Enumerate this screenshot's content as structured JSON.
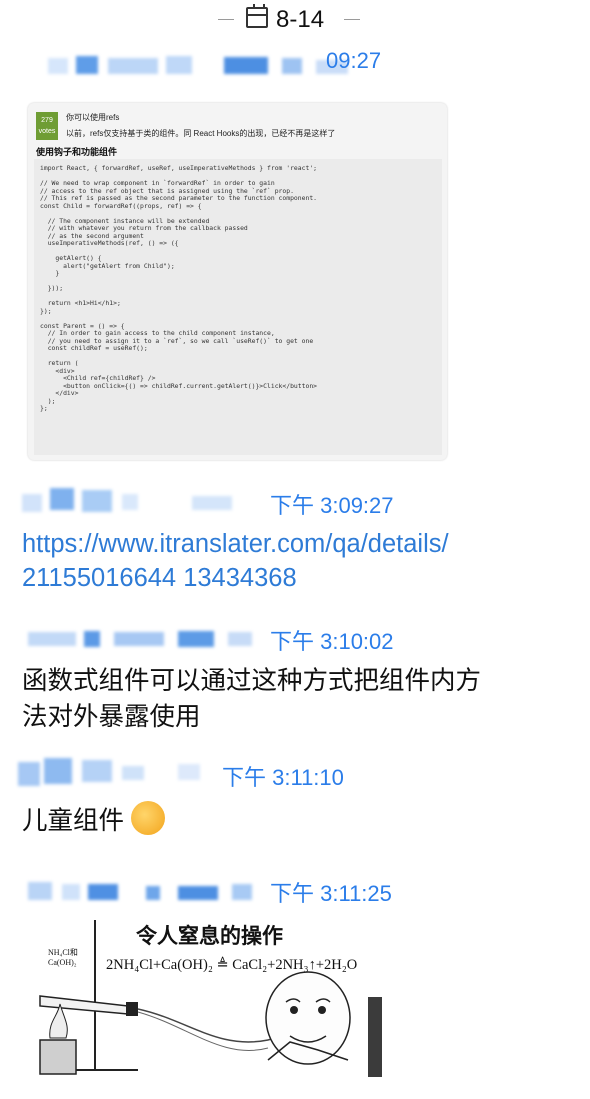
{
  "date_header": {
    "date": "8-14"
  },
  "messages": [
    {
      "time_partial": "09:27",
      "type": "image"
    },
    {
      "time": "下午 3:09:27",
      "type": "link",
      "text_line1": "https://www.itranslater.com/qa/details/",
      "text_line2": "21155016644 13434368"
    },
    {
      "time": "下午 3:10:02",
      "type": "text",
      "line1": "函数式组件可以通过这种方式把组件内方",
      "line2": "法对外暴露使用"
    },
    {
      "time": "下午 3:11:10",
      "type": "text",
      "line1": "儿童组件",
      "emoji": "face-palm-emoji"
    },
    {
      "time": "下午 3:11:25",
      "type": "image-meme"
    }
  ],
  "screenshot_card": {
    "votes": "279",
    "votes_label": "votes",
    "question": "你可以使用refs",
    "note": "以前，refs仅支持基于类的组件。同    React Hooks的出现，已经不再是这样了",
    "heading": "使用钩子和功能组件",
    "code": "import React, { forwardRef, useRef, useImperativeMethods } from 'react';\n\n// We need to wrap component in `forwardRef` in order to gain\n// access to the ref object that is assigned using the `ref` prop.\n// This ref is passed as the second parameter to the function component.\nconst Child = forwardRef((props, ref) => {\n\n  // The component instance will be extended\n  // with whatever you return from the callback passed\n  // as the second argument\n  useImperativeMethods(ref, () => ({\n\n    getAlert() {\n      alert(\"getAlert from Child\");\n    }\n\n  }));\n\n  return <h1>Hi</h1>;\n});\n\nconst Parent = () => {\n  // In order to gain access to the child component instance,\n  // you need to assign it to a `ref`, so we call `useRef()` to get one\n  const childRef = useRef();\n\n  return (\n    <div>\n      <Child ref={childRef} />\n      <button onClick={() => childRef.current.getAlert()}>Click</button>\n    </div>\n  );\n};"
  },
  "meme": {
    "title": "令人窒息的操作",
    "equation": "2NH₄Cl+Ca(OH)₂ ≜ CaCl₂+2NH₃↑+2H₂O",
    "flask_label": "NH₄Cl和\nCa(OH)₂"
  },
  "colors": {
    "link": "#2e7bd6",
    "time": "#2b7de9",
    "vote_green": "#6f9d34"
  }
}
